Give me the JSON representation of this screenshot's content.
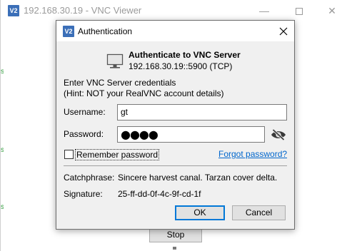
{
  "background_window": {
    "icon_text": "V2",
    "title": "192.168.30.19 - VNC Viewer",
    "minimize_glyph": "—",
    "close_glyph": "✕",
    "stop_label": "Stop"
  },
  "dialog": {
    "icon_text": "V2",
    "title": "Authentication",
    "heading": "Authenticate to VNC Server",
    "server_address": "192.168.30.19::5900 (TCP)",
    "instruction_line1": "Enter VNC Server credentials",
    "instruction_line2": "(Hint: NOT your RealVNC account details)",
    "username_label": "Username:",
    "username_value": "gt",
    "password_label": "Password:",
    "password_masked": "●●●●",
    "remember_label": "Remember password",
    "remember_checked": false,
    "forgot_link": "Forgot password?",
    "catchphrase_label": "Catchphrase:",
    "catchphrase_value": "Sincere harvest canal. Tarzan cover delta.",
    "signature_label": "Signature:",
    "signature_value": "25-ff-dd-0f-4c-9f-cd-1f",
    "ok_label": "OK",
    "cancel_label": "Cancel"
  },
  "icons": {
    "app": "realvnc-icon",
    "server": "monitor-icon",
    "reveal": "eye-slash-icon",
    "close": "close-icon"
  },
  "colors": {
    "app_icon_blue": "#3b6fb8",
    "link_blue": "#0066cc",
    "focus_border": "#0078d7",
    "dialog_bg": "#f0f0f0"
  }
}
